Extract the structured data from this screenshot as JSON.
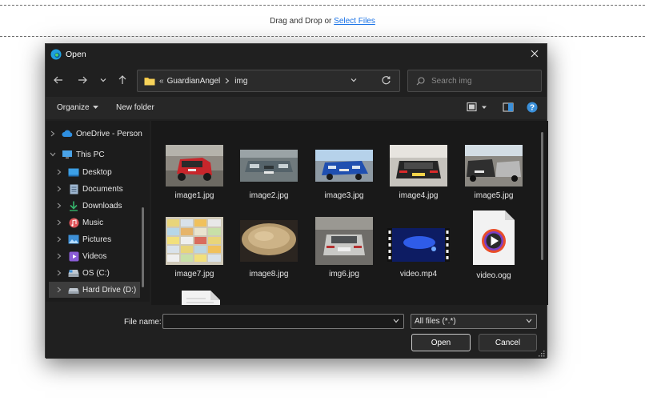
{
  "page": {
    "drop_text": "Drag and Drop or ",
    "select_files": "Select Files"
  },
  "dialog": {
    "title": "Open",
    "address": {
      "segments": [
        "GuardianAngel",
        "img"
      ],
      "separator_prefix": "«"
    },
    "search": {
      "placeholder": "Search img"
    },
    "toolbar": {
      "organize": "Organize",
      "new_folder": "New folder"
    },
    "sidebar": [
      {
        "label": "OneDrive - Person",
        "icon": "cloud-icon"
      },
      {
        "label": "This PC",
        "icon": "computer-icon"
      },
      {
        "label": "Desktop",
        "icon": "desktop-icon"
      },
      {
        "label": "Documents",
        "icon": "documents-icon"
      },
      {
        "label": "Downloads",
        "icon": "downloads-icon"
      },
      {
        "label": "Music",
        "icon": "music-icon"
      },
      {
        "label": "Pictures",
        "icon": "pictures-icon"
      },
      {
        "label": "Videos",
        "icon": "videos-icon"
      },
      {
        "label": "OS (C:)",
        "icon": "drive-icon"
      },
      {
        "label": "Hard Drive (D:)",
        "icon": "drive-icon"
      }
    ],
    "files": [
      {
        "name": "image1.jpg",
        "kind": "image"
      },
      {
        "name": "image2.jpg",
        "kind": "image"
      },
      {
        "name": "image3.jpg",
        "kind": "image"
      },
      {
        "name": "image4.jpg",
        "kind": "image"
      },
      {
        "name": "image5.jpg",
        "kind": "image"
      },
      {
        "name": "image7.jpg",
        "kind": "image"
      },
      {
        "name": "image8.jpg",
        "kind": "image"
      },
      {
        "name": "img6.jpg",
        "kind": "image"
      },
      {
        "name": "video.mp4",
        "kind": "video"
      },
      {
        "name": "video.ogg",
        "kind": "media"
      }
    ],
    "bottom": {
      "file_name_label": "File name:",
      "file_name_value": "",
      "file_type": "All files (*.*)",
      "open_label": "Open",
      "cancel_label": "Cancel"
    }
  },
  "colors": {
    "dialog_bg": "#202020",
    "link": "#1a73e8",
    "folder": "#f4c542",
    "help": "#3a8fd9"
  }
}
